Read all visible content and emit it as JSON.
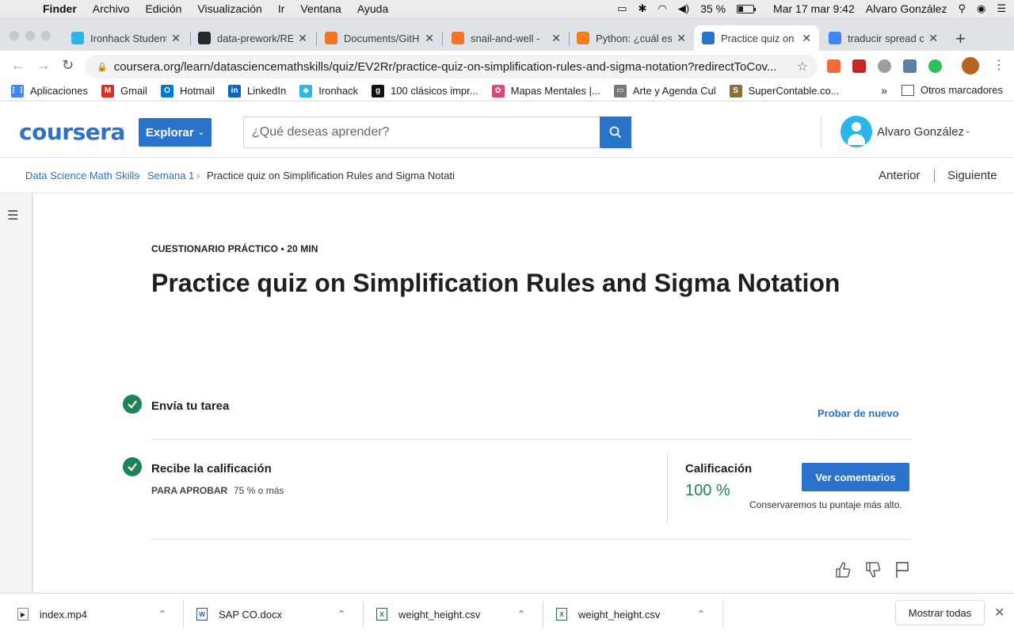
{
  "menubar": {
    "items": [
      "Finder",
      "Archivo",
      "Edición",
      "Visualización",
      "Ir",
      "Ventana",
      "Ayuda"
    ],
    "battery_text": "35 %",
    "battery_level": 0.35,
    "clock": "Mar 17 mar  9:42",
    "user": "Alvaro González"
  },
  "tabs": [
    {
      "title": "Ironhack Student",
      "color": "#2bb5e8"
    },
    {
      "title": "data-prework/RE",
      "color": "#24292e"
    },
    {
      "title": "Documents/GitH",
      "color": "#f37626"
    },
    {
      "title": "snail-and-well -",
      "color": "#f37626"
    },
    {
      "title": "Python: ¿cuál es",
      "color": "#f48024"
    },
    {
      "title": "Practice quiz on",
      "color": "#2a73cc"
    },
    {
      "title": "traducir spread c",
      "color": "#4285f4"
    }
  ],
  "address": {
    "url": "coursera.org/learn/datasciencemathskills/quiz/EV2Rr/practice-quiz-on-simplification-rules-and-sigma-notation?redirectToCov..."
  },
  "bookmarks": [
    {
      "label": "Aplicaciones",
      "color": "#4285f4"
    },
    {
      "label": "Gmail",
      "color": "#d93025"
    },
    {
      "label": "Hotmail",
      "color": "#0078d4"
    },
    {
      "label": "LinkedIn",
      "color": "#0a66c2"
    },
    {
      "label": "Ironhack",
      "color": "#2bb5e8"
    },
    {
      "label": "100 clásicos impr...",
      "color": "#111111"
    },
    {
      "label": "Mapas Mentales |...",
      "color": "#e0457b"
    },
    {
      "label": "Arte y Agenda Cul",
      "color": "#777777"
    },
    {
      "label": "SuperContable.co...",
      "color": "#8a6d3b"
    }
  ],
  "bookmarks_other": "Otros marcadores",
  "coursera": {
    "logo": "coursera",
    "explore": "Explorar",
    "search_placeholder": "¿Qué deseas aprender?",
    "user_name": "Alvaro González"
  },
  "breadcrumb": {
    "course": "Data Science Math Skills",
    "week": "Semana 1",
    "current": "Practice quiz on Simplification Rules and Sigma Notati",
    "prev": "Anterior",
    "next": "Siguiente"
  },
  "quiz": {
    "eyebrow": "CUESTIONARIO PRÁCTICO • 20 MIN",
    "title": "Practice quiz on Simplification Rules and Sigma Notation",
    "step1": "Envía tu tarea",
    "retry": "Probar de nuevo",
    "step2": "Recibe la calificación",
    "pass_label": "PARA APROBAR",
    "pass_value": "75 % o más",
    "grade_label": "Calificación",
    "grade_value": "100 %",
    "feedback_button": "Ver comentarios",
    "keep_note": "Conservaremos tu puntaje más alto."
  },
  "downloads": [
    {
      "name": "index.mp4"
    },
    {
      "name": "SAP CO.docx"
    },
    {
      "name": "weight_height.csv"
    },
    {
      "name": "weight_height.csv"
    }
  ],
  "downloads_show_all": "Mostrar todas",
  "colors": {
    "accent": "#2a73cc",
    "success": "#1f8354"
  }
}
